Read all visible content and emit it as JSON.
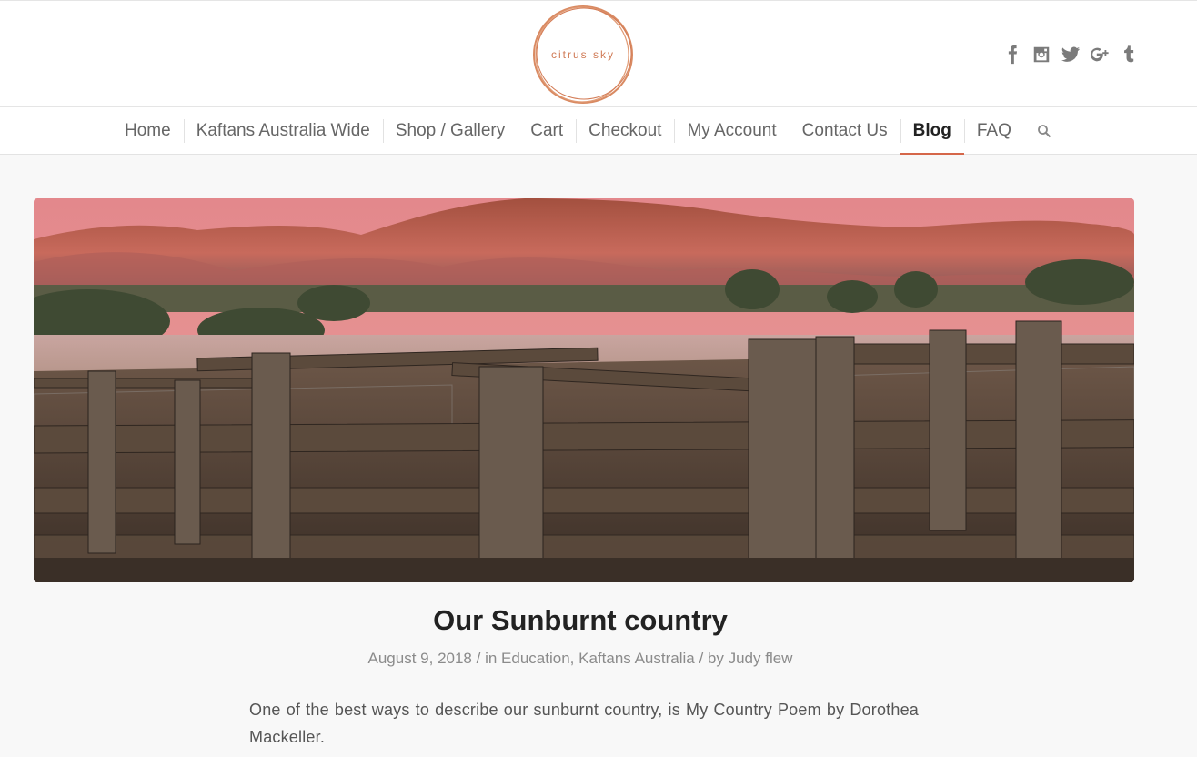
{
  "brand": {
    "logo_text": "citrus sky",
    "accent_color": "#d5674a"
  },
  "social": [
    {
      "name": "facebook",
      "icon": "facebook-icon",
      "glyph": "f"
    },
    {
      "name": "instagram",
      "icon": "instagram-icon",
      "glyph": ""
    },
    {
      "name": "twitter",
      "icon": "twitter-icon",
      "glyph": ""
    },
    {
      "name": "google-plus",
      "icon": "google-plus-icon",
      "glyph": "g+"
    },
    {
      "name": "tumblr",
      "icon": "tumblr-icon",
      "glyph": "t"
    }
  ],
  "nav": {
    "items": [
      {
        "label": "Home"
      },
      {
        "label": "Kaftans Australia Wide"
      },
      {
        "label": "Shop / Gallery"
      },
      {
        "label": "Cart"
      },
      {
        "label": "Checkout"
      },
      {
        "label": "My Account"
      },
      {
        "label": "Contact Us"
      },
      {
        "label": "Blog",
        "active": true
      },
      {
        "label": "FAQ"
      }
    ],
    "search_icon": "search-icon"
  },
  "post": {
    "title": "Our Sunburnt country",
    "date": "August 9, 2018",
    "in_label": "/ in",
    "category_1": "Education",
    "category_2": "Kaftans Australia",
    "by_label": "/ by",
    "author": "Judy flew",
    "body": "One of the best ways to describe our sunburnt country, is My Country Poem by Dorothea Mackeller."
  }
}
